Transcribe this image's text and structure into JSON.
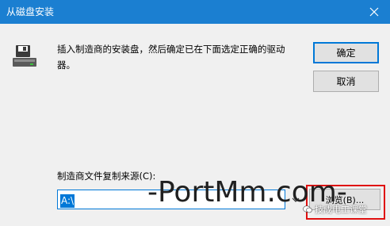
{
  "window": {
    "title": "从磁盘安装",
    "close_icon": "close-icon"
  },
  "message": "插入制造商的安装盘，然后确定已在下面选定正确的驱动器。",
  "buttons": {
    "ok_label": "确定",
    "cancel_label": "取消",
    "browse_label": "浏览(B)..."
  },
  "copy_from": {
    "label": "制造商文件复制来源(C):",
    "value": "A:\\"
  },
  "watermarks": {
    "main": "-PortMm.com-",
    "secondary": "技成电工课堂"
  },
  "colors": {
    "titlebar": "#1b7fd1",
    "accent": "#0078d7",
    "highlight_border": "#e01010"
  }
}
